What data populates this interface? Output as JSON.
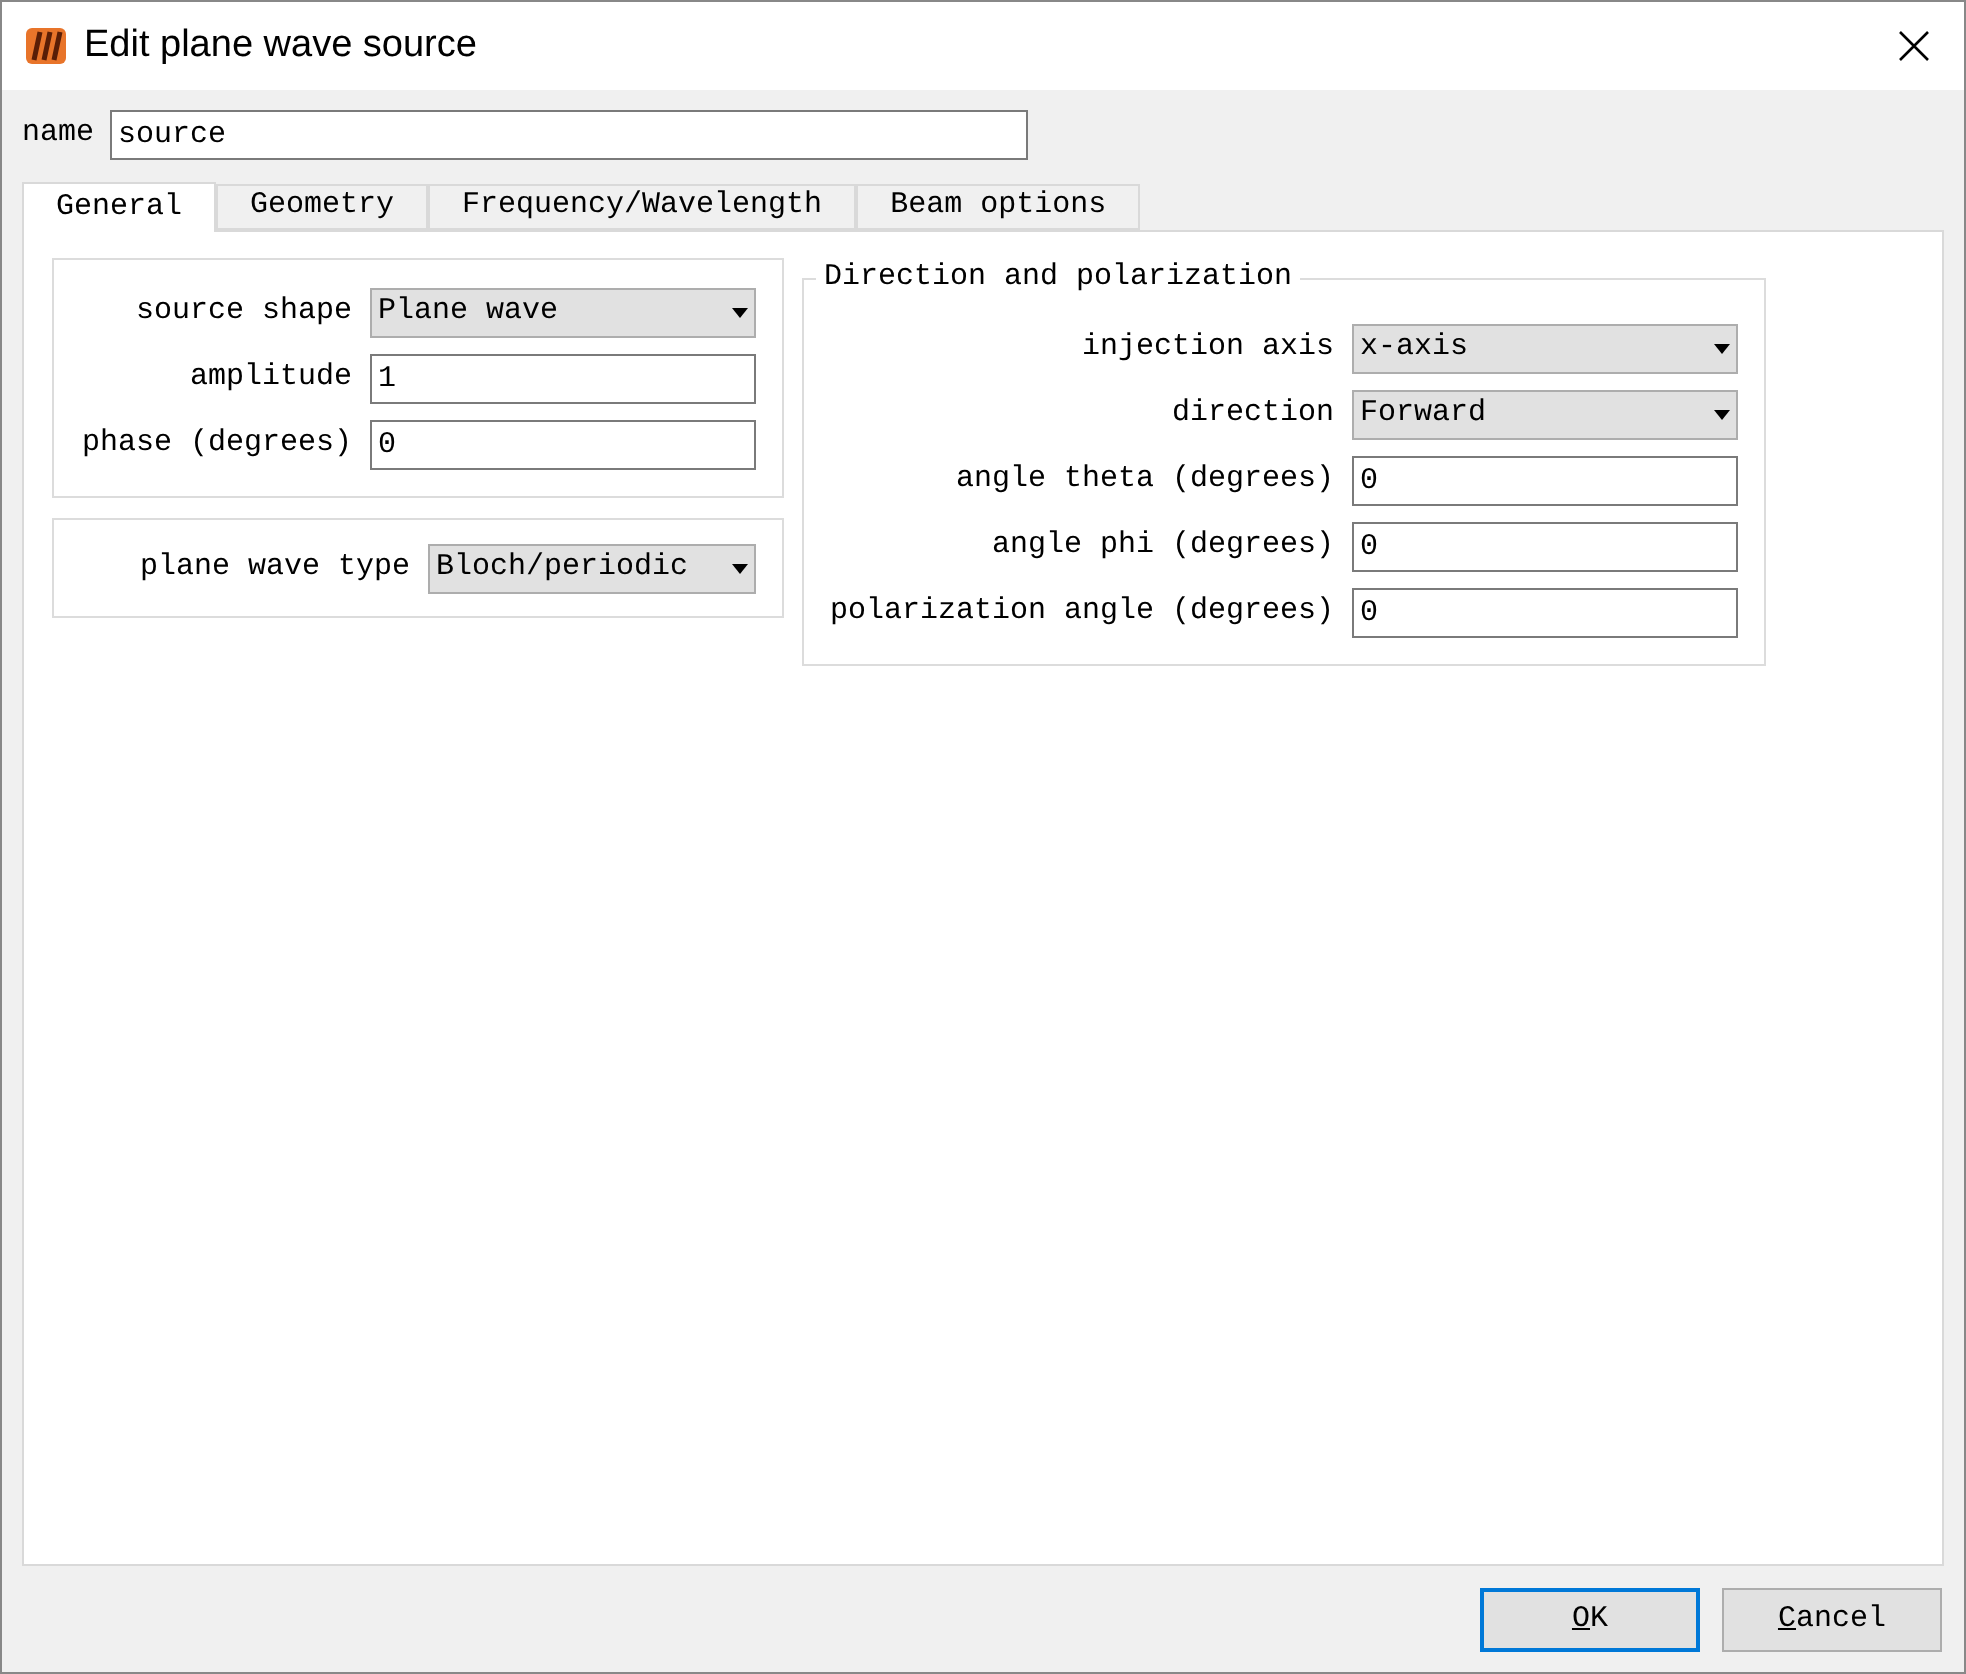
{
  "window": {
    "title": "Edit plane wave source"
  },
  "name_field": {
    "label": "name",
    "value": "source"
  },
  "tabs": [
    {
      "label": "General",
      "selected": true
    },
    {
      "label": "Geometry",
      "selected": false
    },
    {
      "label": "Frequency/Wavelength",
      "selected": false
    },
    {
      "label": "Beam options",
      "selected": false
    }
  ],
  "source_group": [
    {
      "label": "source shape",
      "kind": "dropdown",
      "value": "Plane wave"
    },
    {
      "label": "amplitude",
      "kind": "input",
      "value": "1"
    },
    {
      "label": "phase (degrees)",
      "kind": "input",
      "value": "0"
    }
  ],
  "type_group": [
    {
      "label": "plane wave type",
      "kind": "dropdown",
      "value": "Bloch/periodic"
    }
  ],
  "direction_group": {
    "title": "Direction and polarization",
    "fields": [
      {
        "label": "injection axis",
        "kind": "dropdown",
        "value": "x-axis"
      },
      {
        "label": "direction",
        "kind": "dropdown",
        "value": "Forward"
      },
      {
        "label": "angle theta (degrees)",
        "kind": "input",
        "value": "0"
      },
      {
        "label": "angle phi (degrees)",
        "kind": "input",
        "value": "0"
      },
      {
        "label": "polarization angle (degrees)",
        "kind": "input",
        "value": "0"
      }
    ]
  },
  "buttons": [
    {
      "label": "OK",
      "default": true
    },
    {
      "label": "Cancel",
      "default": false
    }
  ]
}
